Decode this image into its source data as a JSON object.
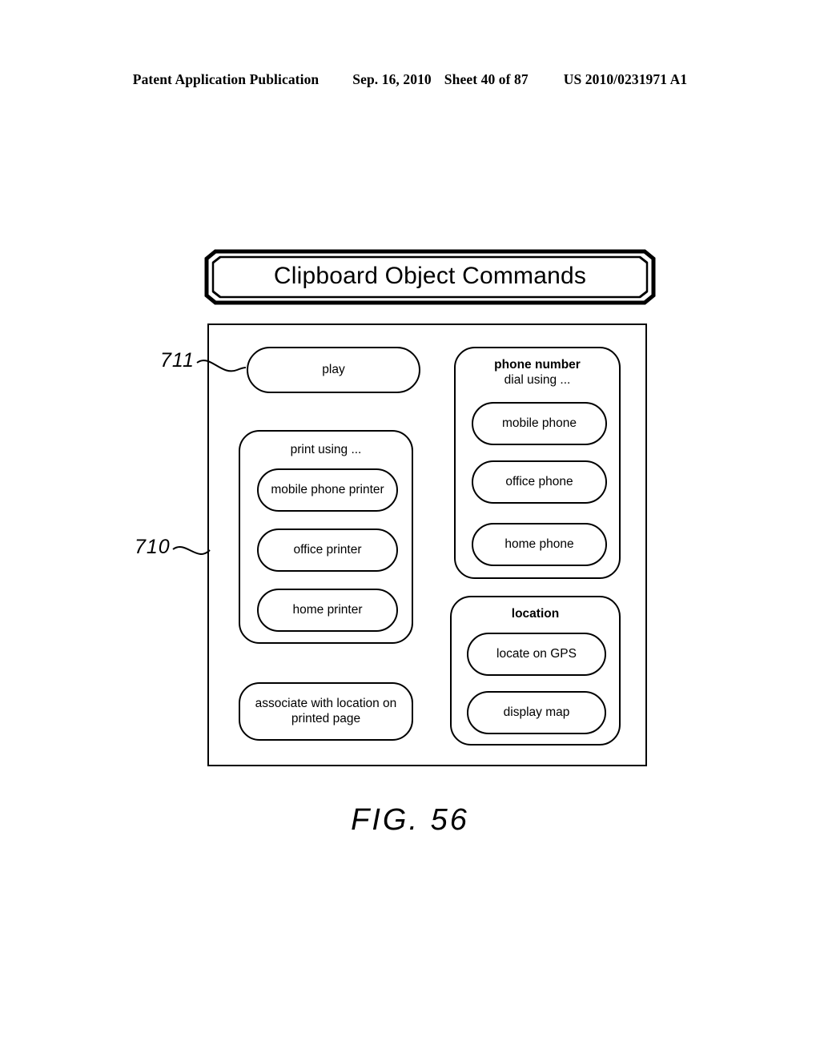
{
  "header": {
    "publication": "Patent Application Publication",
    "date": "Sep. 16, 2010",
    "sheet": "Sheet 40 of 87",
    "patent_number": "US 2010/0231971 A1"
  },
  "banner": {
    "title": "Clipboard Object Commands"
  },
  "panel": {
    "reference_numeral": "710",
    "play_reference_numeral": "711",
    "play_button": "play",
    "associate_button_line1": "associate with location on",
    "associate_button_line2": "printed page",
    "print_group": {
      "title": "print using ...",
      "options": [
        "mobile phone printer",
        "office printer",
        "home printer"
      ]
    },
    "phone_group": {
      "title_bold": "phone number",
      "title_regular": "dial using ...",
      "options": [
        "mobile phone",
        "office phone",
        "home phone"
      ]
    },
    "location_group": {
      "title_bold": "location",
      "options": [
        "locate on GPS",
        "display map"
      ]
    }
  },
  "figure": {
    "caption": "FIG. 56"
  },
  "colors": {
    "ink": "#000000",
    "paper": "#ffffff"
  }
}
